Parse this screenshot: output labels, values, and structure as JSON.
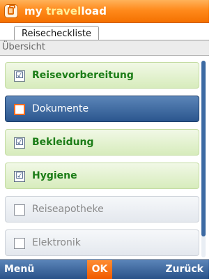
{
  "app": {
    "title_prefix": "my ",
    "title_brand": "travel",
    "title_suffix": "load",
    "icon": "luggage-icon"
  },
  "tab": {
    "label": "Reisecheckliste"
  },
  "subheader": {
    "label": "Übersicht"
  },
  "list": {
    "items": [
      {
        "label": "Reisevorbereitung",
        "checked": true,
        "check_glyph": "☑",
        "state": "green"
      },
      {
        "label": "Dokumente",
        "checked": false,
        "check_glyph": "",
        "state": "selected"
      },
      {
        "label": "Bekleidung",
        "checked": true,
        "check_glyph": "☑",
        "state": "green"
      },
      {
        "label": "Hygiene",
        "checked": true,
        "check_glyph": "☑",
        "state": "green"
      },
      {
        "label": "Reiseapotheke",
        "checked": false,
        "check_glyph": "",
        "state": "gray"
      },
      {
        "label": "Elektronik",
        "checked": false,
        "check_glyph": "",
        "state": "gray"
      }
    ]
  },
  "softkeys": {
    "left": "Menü",
    "center": "OK",
    "right": "Zurück"
  },
  "colors": {
    "accent": "#f47100",
    "checked_bg": "#d7ecbc",
    "selected_bg": "#2b568e",
    "softbar": "#2a5288"
  }
}
